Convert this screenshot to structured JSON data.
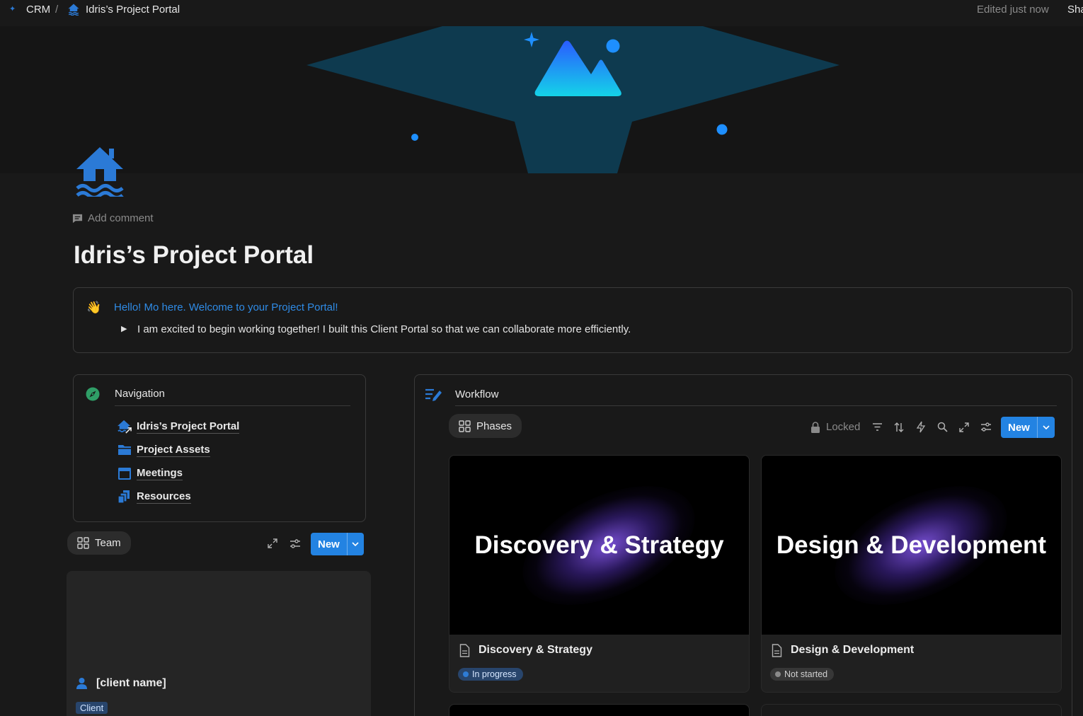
{
  "topbar": {
    "breadcrumb_root": "CRM",
    "breadcrumb_separator": "/",
    "breadcrumb_page": "Idris’s Project Portal",
    "edited": "Edited just now",
    "share": "Share"
  },
  "page": {
    "add_comment": "Add comment",
    "title": "Idris’s Project Portal"
  },
  "callout": {
    "heading": "Hello! Mo here. Welcome to your Project Portal!",
    "toggle_text": "I am excited to begin working together! I built this Client Portal so that we can collaborate more efficiently."
  },
  "navigation": {
    "heading": "Navigation",
    "items": [
      {
        "label": "Idris’s Project Portal",
        "icon": "house-icon"
      },
      {
        "label": "Project Assets",
        "icon": "folder-icon"
      },
      {
        "label": "Meetings",
        "icon": "calendar-icon"
      },
      {
        "label": "Resources",
        "icon": "stacked-docs-icon"
      }
    ]
  },
  "team": {
    "view_label": "Team",
    "new_label": "New",
    "card_name": "[client name]",
    "card_tag": "Client"
  },
  "workflow": {
    "heading": "Workflow",
    "view_label": "Phases",
    "locked_label": "Locked",
    "new_label": "New",
    "cards": [
      {
        "cover_text": "Discovery & Strategy",
        "title": "Discovery & Strategy",
        "status": "In progress"
      },
      {
        "cover_text": "Design & Development",
        "title": "Design & Development",
        "status": "Not started"
      }
    ]
  },
  "colors": {
    "accent": "#2383e2",
    "page_bg": "#191919",
    "in_progress_bg": "#28456c",
    "in_progress_dot": "#2e7cd6",
    "not_started_bg": "#373737",
    "not_started_dot": "#8a8a8a",
    "client_tag_bg": "#28456c",
    "icon_blue": "#2b7ad6",
    "nav_icon_green": "#2f9e67"
  }
}
